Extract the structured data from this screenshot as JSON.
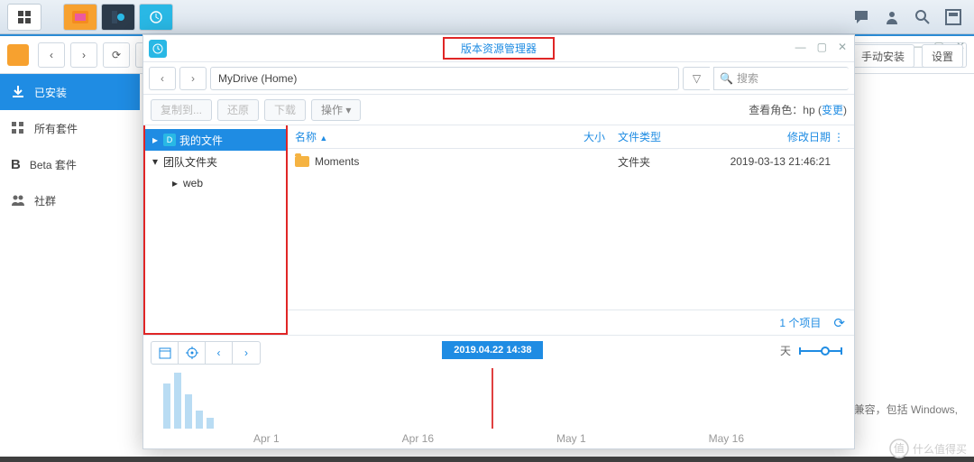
{
  "topbar_icons": [
    "apps",
    "documents",
    "drive",
    "history"
  ],
  "bg": {
    "search_ph": "搜索",
    "side": [
      "已安装",
      "所有套件",
      "Beta 套件",
      "社群"
    ],
    "btn_manual": "手动安装",
    "btn_settings": "设置",
    "footer": "户端兼容，包括 Windows,"
  },
  "vw": {
    "title": "版本资源管理器",
    "crumb": "MyDrive (Home)",
    "search_ph": "搜索",
    "actions": {
      "copy": "复制到...",
      "restore": "还原",
      "download": "下载",
      "ops": "操作"
    },
    "role_label": "查看角色：",
    "role_user": "hp",
    "role_change": "变更",
    "tree": {
      "my": "我的文件",
      "team": "团队文件夹",
      "web": "web"
    },
    "cols": {
      "name": "名称",
      "size": "大小",
      "type": "文件类型",
      "date": "修改日期"
    },
    "rows": [
      {
        "name": "Moments",
        "type": "文件夹",
        "date": "2019-03-13 21:46:21"
      }
    ],
    "status": "1 个项目",
    "timeline": {
      "label": "2019.04.22 14:38",
      "unit": "天",
      "ticks": [
        "Apr 1",
        "Apr 16",
        "May 1",
        "May 16"
      ]
    }
  },
  "watermark": "什么值得买"
}
